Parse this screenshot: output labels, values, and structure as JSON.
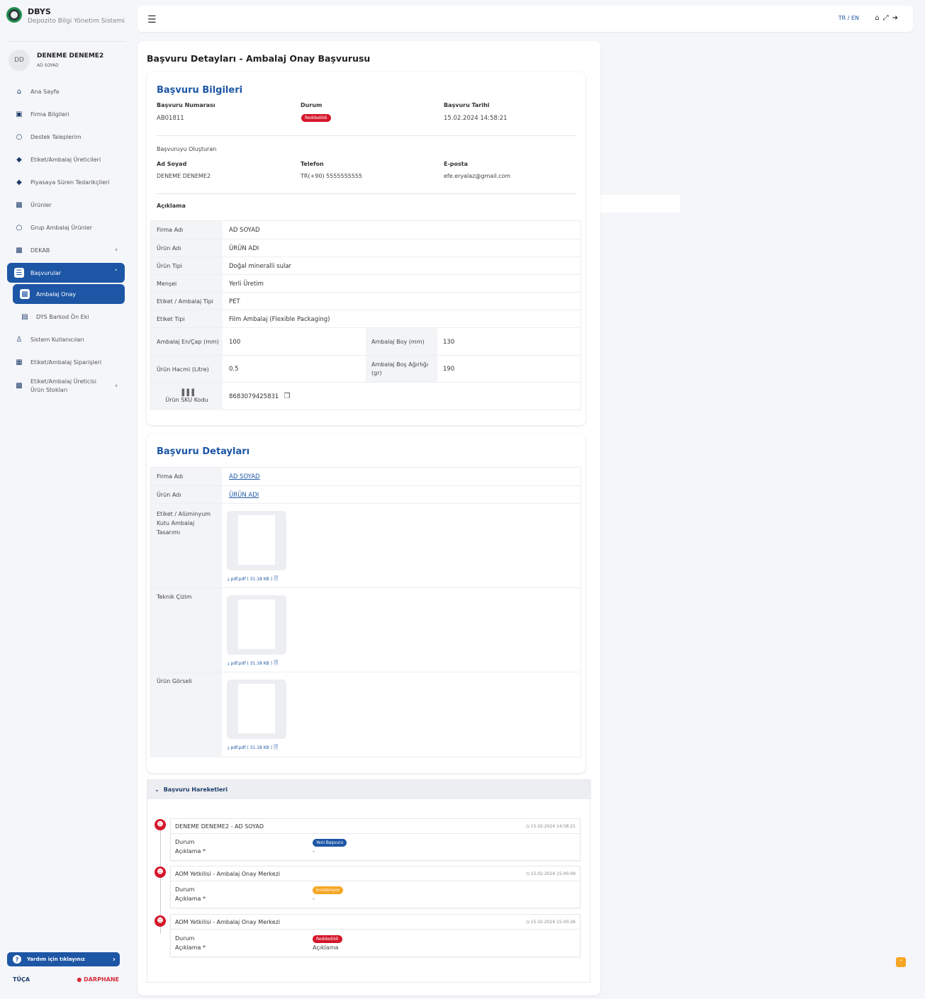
{
  "brand": {
    "title": "DBYS",
    "subtitle": "Depozito Bilgi Yönetim Sistemi"
  },
  "user": {
    "initials": "DD",
    "name": "DENEME DENEME2",
    "role": "AD SOYAD"
  },
  "sidebar": {
    "items": [
      {
        "label": "Ana Sayfa",
        "icon": "home-icon"
      },
      {
        "label": "Firma Bilgileri",
        "icon": "briefcase-icon"
      },
      {
        "label": "Destek Taleplerim",
        "icon": "circle-icon"
      },
      {
        "label": "Etiket/Ambalaj Üreticileri",
        "icon": "tag-icon"
      },
      {
        "label": "Piyasaya Süren Tedarikçileri",
        "icon": "tag-icon"
      },
      {
        "label": "Ürünler",
        "icon": "boxes-icon"
      },
      {
        "label": "Grup Ambalaj Ürünler",
        "icon": "circle-icon"
      },
      {
        "label": "DEKAB",
        "icon": "boxes-icon"
      },
      {
        "label": "Başvurular",
        "icon": "list-icon"
      },
      {
        "label": "Ambalaj Onay",
        "icon": "stamp-icon"
      },
      {
        "label": "DYS Barkod Ön Eki",
        "icon": "barcode-icon"
      },
      {
        "label": "Sistem Kullanıcıları",
        "icon": "users-icon"
      },
      {
        "label": "Etiket/Ambalaj Siparişleri",
        "icon": "grid-icon"
      },
      {
        "label": "Etiket/Ambalaj Üreticisi Ürün Stokları",
        "icon": "stock-icon"
      }
    ],
    "help_label": "Yardım için tıklayınız",
    "logo1": "TÜÇA",
    "logo2": "DARPHANE"
  },
  "topbar": {
    "lang": "TR / EN"
  },
  "page": {
    "title": "Başvuru Detayları - Ambalaj Onay Başvurusu"
  },
  "info": {
    "title": "Başvuru Bilgileri",
    "no_label": "Başvuru Numarası",
    "no_value": "AB01811",
    "status_label": "Durum",
    "status_value": "Reddedildi",
    "date_label": "Başvuru Tarihi",
    "date_value": "15.02.2024 14:58:21",
    "creator_heading": "Başvuruyu Oluşturan",
    "name_label": "Ad Soyad",
    "name_value": "DENEME DENEME2",
    "phone_label": "Telefon",
    "phone_value": "TR(+90) 5555555555",
    "email_label": "E-posta",
    "email_value": "efe.eryalaz@gmail.com",
    "desc_label": "Açıklama",
    "table": {
      "firma_k": "Firma Adı",
      "firma_v": "AD SOYAD",
      "urun_k": "Ürün Adı",
      "urun_v": "ÜRÜN ADI",
      "tip_k": "Ürün Tipi",
      "tip_v": "Doğal mineralli sular",
      "mense_k": "Menşei",
      "mense_v": "Yerli Üretim",
      "etamb_k": "Etiket / Ambalaj Tipi",
      "etamb_v": "PET",
      "etiket_k": "Etiket Tipi",
      "etiket_v": "Film Ambalaj (Flexible Packaging)",
      "en_k": "Ambalaj En/Çap (mm)",
      "en_v": "100",
      "boy_k": "Ambalaj Boy (mm)",
      "boy_v": "130",
      "hacim_k": "Ürün Hacmi (Litre)",
      "hacim_v": "0.5",
      "agirlik_k": "Ambalaj Boş Ağırlığı (gr)",
      "agirlik_v": "190",
      "sku_k": "Ürün SKU Kodu",
      "sku_v": "8683079425831"
    }
  },
  "details": {
    "title": "Başvuru Detayları",
    "firma_k": "Firma Adı",
    "firma_v": "AD SOYAD",
    "urun_k": "Ürün Adı",
    "urun_v": "ÜRÜN ADI",
    "tasarim_k": "Etiket / Alüminyum Kutu Ambalaj Tasarımı",
    "cizim_k": "Teknik Çizim",
    "gorsel_k": "Ürün Görseli",
    "file_label": "pdf.pdf ( 31.18 KB )"
  },
  "history": {
    "title": "Başvuru Hareketleri",
    "durum_label": "Durum",
    "aciklama_label": "Açıklama *",
    "entries": [
      {
        "who": "DENEME DENEME2 - AD SOYAD",
        "time": "15.02.2024 14:58:21",
        "status": "Yeni Başvuru",
        "note": "-"
      },
      {
        "who": "AOM Yetkilisi - Ambalaj Onay Merkezi",
        "time": "15.02.2024 15:00:09",
        "status": "İnceleniyor",
        "note": "-"
      },
      {
        "who": "AOM Yetkilisi - Ambalaj Onay Merkezi",
        "time": "15.02.2024 15:00:26",
        "status": "Reddedildi",
        "note": "Açıklama"
      }
    ]
  }
}
